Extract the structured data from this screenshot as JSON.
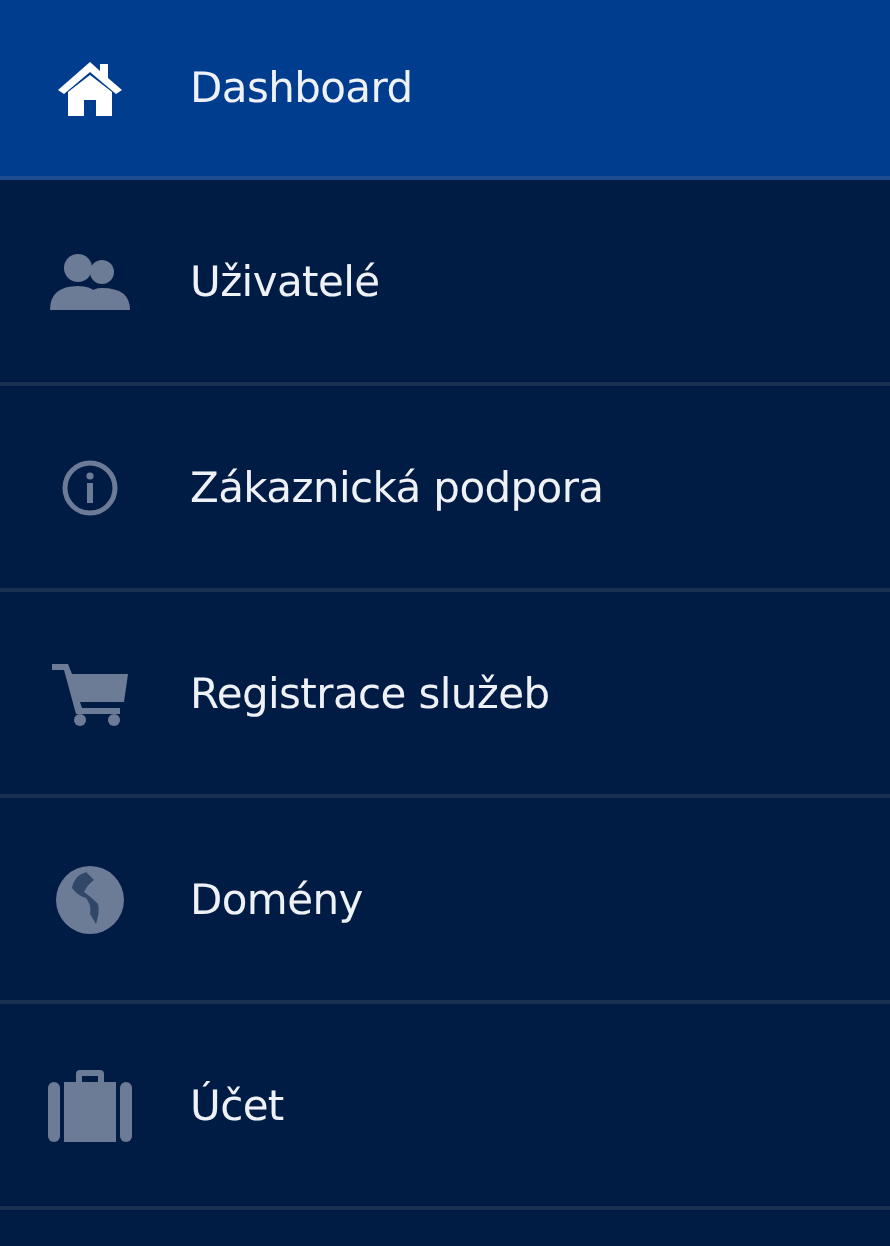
{
  "menu": [
    {
      "label": "Dashboard",
      "kind": "home",
      "selected": true
    },
    {
      "label": "Uživatelé",
      "kind": "users",
      "selected": false
    },
    {
      "label": "Zákaznická podpora",
      "kind": "info",
      "selected": false
    },
    {
      "label": "Registrace služeb",
      "kind": "cart",
      "selected": false
    },
    {
      "label": "Domény",
      "kind": "globe",
      "selected": false
    },
    {
      "label": "Účet",
      "kind": "briefcase",
      "selected": false
    }
  ]
}
